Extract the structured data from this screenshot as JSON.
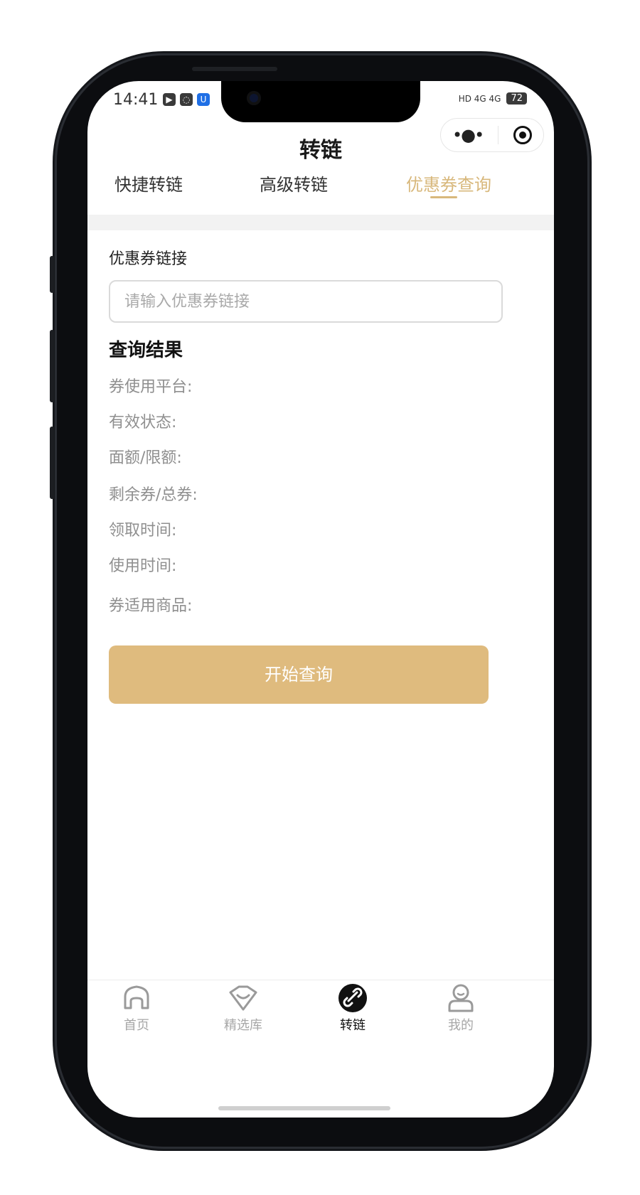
{
  "status": {
    "time": "14:41",
    "right_text": "HD 4G 4G",
    "battery": "72"
  },
  "header": {
    "title": "转链",
    "menu_icon": "more-dots-icon",
    "target_icon": "record-target-icon"
  },
  "tabs": [
    {
      "label": "快捷转链"
    },
    {
      "label": "高级转链"
    },
    {
      "label": "优惠券查询"
    }
  ],
  "form": {
    "label": "优惠券链接",
    "placeholder": "请输入优惠券链接"
  },
  "results": {
    "title": "查询结果",
    "items": [
      "券使用平台:",
      "有效状态:",
      "面额/限额:",
      "剩余券/总券:",
      "领取时间:",
      "使用时间:",
      "券适用商品:"
    ]
  },
  "button": {
    "label": "开始查询"
  },
  "bottom_nav": [
    {
      "label": "首页",
      "icon": "home-icon"
    },
    {
      "label": "精选库",
      "icon": "gem-icon"
    },
    {
      "label": "转链",
      "icon": "link-icon"
    },
    {
      "label": "我的",
      "icon": "user-icon"
    }
  ],
  "colors": {
    "accent": "#dfbb7e",
    "tab_active": "#d8b87c"
  }
}
